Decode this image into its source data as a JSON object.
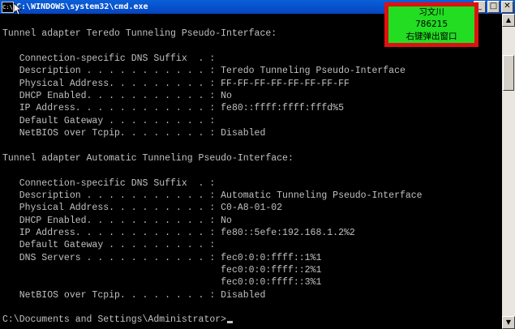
{
  "window": {
    "title": "C:\\WINDOWS\\system32\\cmd.exe",
    "icon_label": "C:\\",
    "buttons": {
      "minimize": "_",
      "maximize": "□",
      "close": "✕"
    }
  },
  "overlay": {
    "name": "习文川",
    "number": "786215",
    "hint": "右键弹出窗口"
  },
  "console": {
    "lines": [
      "",
      "Tunnel adapter Teredo Tunneling Pseudo-Interface:",
      "",
      "   Connection-specific DNS Suffix  . :",
      "   Description . . . . . . . . . . . : Teredo Tunneling Pseudo-Interface",
      "   Physical Address. . . . . . . . . : FF-FF-FF-FF-FF-FF-FF-FF",
      "   DHCP Enabled. . . . . . . . . . . : No",
      "   IP Address. . . . . . . . . . . . : fe80::ffff:ffff:fffd%5",
      "   Default Gateway . . . . . . . . . :",
      "   NetBIOS over Tcpip. . . . . . . . : Disabled",
      "",
      "Tunnel adapter Automatic Tunneling Pseudo-Interface:",
      "",
      "   Connection-specific DNS Suffix  . :",
      "   Description . . . . . . . . . . . : Automatic Tunneling Pseudo-Interface",
      "   Physical Address. . . . . . . . . : C0-A8-01-02",
      "   DHCP Enabled. . . . . . . . . . . : No",
      "   IP Address. . . . . . . . . . . . : fe80::5efe:192.168.1.2%2",
      "   Default Gateway . . . . . . . . . :",
      "   DNS Servers . . . . . . . . . . . : fec0:0:0:ffff::1%1",
      "                                       fec0:0:0:ffff::2%1",
      "                                       fec0:0:0:ffff::3%1",
      "   NetBIOS over Tcpip. . . . . . . . : Disabled",
      "",
      "C:\\Documents and Settings\\Administrator>"
    ]
  },
  "colors": {
    "titlebar": "#0545c1",
    "console_bg": "#000000",
    "console_fg": "#c0c0c0",
    "overlay_border": "#e01010",
    "overlay_fill": "#22dd22"
  }
}
